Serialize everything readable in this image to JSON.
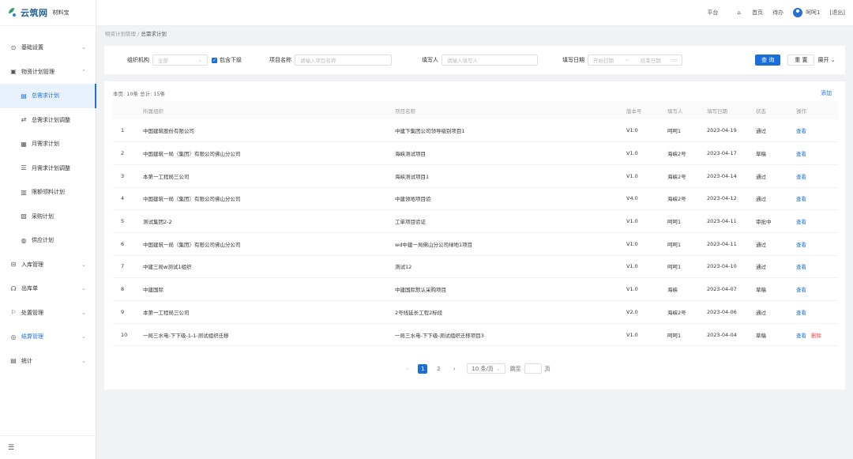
{
  "app": {
    "logo_text": "云筑网",
    "logo_sub": "材料宝"
  },
  "header": {
    "platform": "平台",
    "home": "首页",
    "todo": "待办",
    "user_name": "呵呵1",
    "logout": "[退出]"
  },
  "sidebar": {
    "items": [
      {
        "label": "基础设置",
        "icon": "gear-icon"
      },
      {
        "label": "物资计划管理",
        "icon": "calendar-icon"
      },
      {
        "label": "入库管理",
        "icon": "inbox-icon"
      },
      {
        "label": "出库单",
        "icon": "headset-icon"
      },
      {
        "label": "处置管理",
        "icon": "flag-icon"
      },
      {
        "label": "结算管理",
        "icon": "settle-icon"
      },
      {
        "label": "统计",
        "icon": "stats-icon"
      }
    ],
    "sub_items": [
      {
        "label": "总需求计划",
        "icon": "doc-icon"
      },
      {
        "label": "总需求计划调整",
        "icon": "adjust-icon"
      },
      {
        "label": "月需求计划",
        "icon": "calendar-icon"
      },
      {
        "label": "月需求计划调整",
        "icon": "list-icon"
      },
      {
        "label": "限额领料计划",
        "icon": "stack-icon"
      },
      {
        "label": "采购计划",
        "icon": "clipboard-icon"
      },
      {
        "label": "供应计划",
        "icon": "supply-icon"
      }
    ]
  },
  "breadcrumb": {
    "parent": "物资计划管理",
    "separator": "/",
    "current": "总需求计划"
  },
  "filter": {
    "org_label": "组织机构",
    "org_value": "全部",
    "include_sub": "包含下级",
    "project_label": "项目名称",
    "project_placeholder": "请输入项目名称",
    "filler_label": "填写人",
    "filler_placeholder": "请输入填写人",
    "date_label": "填写日期",
    "date_start": "开始日期",
    "date_sep": "~",
    "date_end": "结束日期",
    "search_btn": "查 询",
    "reset_btn": "重 置",
    "expand_btn": "展开"
  },
  "table": {
    "summary": "本页: 10条  总计: 15条",
    "add_label": "添加",
    "columns": [
      "",
      "所属组织",
      "项目名称",
      "版本号",
      "填写人",
      "填写日期",
      "状态",
      "操作"
    ],
    "view_label": "查看",
    "delete_label": "删除",
    "rows": [
      {
        "no": "1",
        "org": "中国建筑股份有限公司",
        "project": "中建下集团公司领导级别项目1",
        "version": "V1.0",
        "filler": "呵呵1",
        "date": "2023-04-19",
        "status": "通过"
      },
      {
        "no": "2",
        "org": "中国建筑一局（集团）有限公司佛山分公司",
        "project": "海峡测试项目",
        "version": "V1.0",
        "filler": "海峡2号",
        "date": "2023-04-17",
        "status": "草稿"
      },
      {
        "no": "3",
        "org": "本第一工程局三公司",
        "project": "海峡测试项目1",
        "version": "V1.0",
        "filler": "海峡2号",
        "date": "2023-04-14",
        "status": "通过"
      },
      {
        "no": "4",
        "org": "中国建筑一局（集团）有限公司佛山分公司",
        "project": "中建领地项目验",
        "version": "V4.0",
        "filler": "海峡2号",
        "date": "2023-04-12",
        "status": "通过"
      },
      {
        "no": "5",
        "org": "测试集团2-2",
        "project": "工单项目验证",
        "version": "V1.0",
        "filler": "呵呵1",
        "date": "2023-04-11",
        "status": "审批中"
      },
      {
        "no": "6",
        "org": "中国建筑一局（集团）有限公司佛山分公司",
        "project": "wd中建一局佛山分公司绿地1项目",
        "version": "V1.0",
        "filler": "呵呵1",
        "date": "2023-04-11",
        "status": "通过"
      },
      {
        "no": "7",
        "org": "中建三局w测试1组织",
        "project": "测试12",
        "version": "V1.0",
        "filler": "呵呵1",
        "date": "2023-04-10",
        "status": "通过"
      },
      {
        "no": "8",
        "org": "中建国际",
        "project": "中建国际默认采购项目",
        "version": "V1.0",
        "filler": "海峡",
        "date": "2023-04-07",
        "status": "草稿"
      },
      {
        "no": "9",
        "org": "本第一工程局三公司",
        "project": "2号线延长工程2标段",
        "version": "V2.0",
        "filler": "海峡2号",
        "date": "2023-04-06",
        "status": "通过"
      },
      {
        "no": "10",
        "org": "一局三水电-下下级-1-1-测试组织迁移",
        "project": "一局三水电-下下级-测试组织迁移项目3",
        "version": "V1.0",
        "filler": "呵呵1",
        "date": "2023-04-04",
        "status": "草稿",
        "deletable": true
      }
    ]
  },
  "pagination": {
    "prev": "‹",
    "pages": [
      "1",
      "2"
    ],
    "current": "1",
    "next": "›",
    "page_size": "10 条/页",
    "goto_label": "跳至",
    "page_unit": "页"
  },
  "colors": {
    "primary": "#1a6fd8",
    "danger": "#f04848"
  }
}
